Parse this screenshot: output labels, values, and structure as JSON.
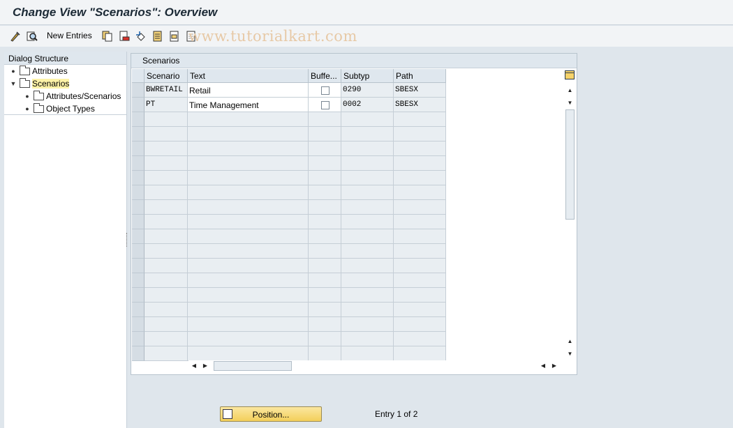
{
  "title": "Change View \"Scenarios\": Overview",
  "toolbar": {
    "new_entries_label": "New Entries",
    "watermark": "www.tutorialkart.com",
    "icons": [
      "display-change-icon",
      "details-icon",
      "copy-icon",
      "delete-icon",
      "undo-icon",
      "select-all-icon",
      "select-block-icon",
      "deselect-all-icon"
    ]
  },
  "dialog_structure": {
    "header": "Dialog Structure",
    "items": [
      {
        "label": "Attributes"
      },
      {
        "label": "Scenarios"
      },
      {
        "label": "Attributes/Scenarios"
      },
      {
        "label": "Object Types"
      }
    ]
  },
  "table": {
    "title": "Scenarios",
    "columns": [
      "Scenario",
      "Text",
      "Buffe...",
      "Subtyp",
      "Path"
    ],
    "rows": [
      {
        "scenario": "BWRETAIL",
        "text": "Retail",
        "buffered": false,
        "subtyp": "0290",
        "path": "SBESX"
      },
      {
        "scenario": "PT",
        "text": "Time Management",
        "buffered": false,
        "subtyp": "0002",
        "path": "SBESX"
      }
    ],
    "empty_rows": 17
  },
  "footer": {
    "position_label": "Position...",
    "entry_info": "Entry 1 of 2"
  },
  "colors": {
    "selected_tree_item": "#fdf2a7",
    "position_button": "#f3cf5a"
  }
}
